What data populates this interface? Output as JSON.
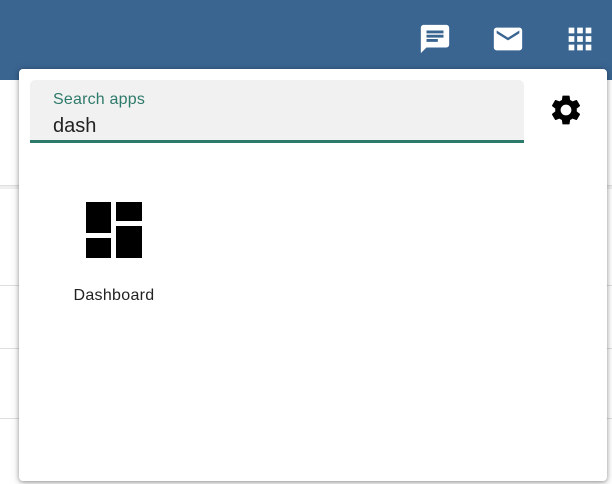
{
  "topbar": {
    "icons": [
      "chat-icon",
      "mail-icon",
      "apps-grid-icon"
    ],
    "background": "#3a6591"
  },
  "launcher": {
    "search": {
      "label": "Search apps",
      "value": "dash"
    },
    "settings_icon": "gear-icon",
    "results": [
      {
        "name": "Dashboard",
        "icon": "dashboard-icon"
      }
    ]
  },
  "colors": {
    "accent": "#2e7a6a",
    "topbar": "#3a6591"
  }
}
